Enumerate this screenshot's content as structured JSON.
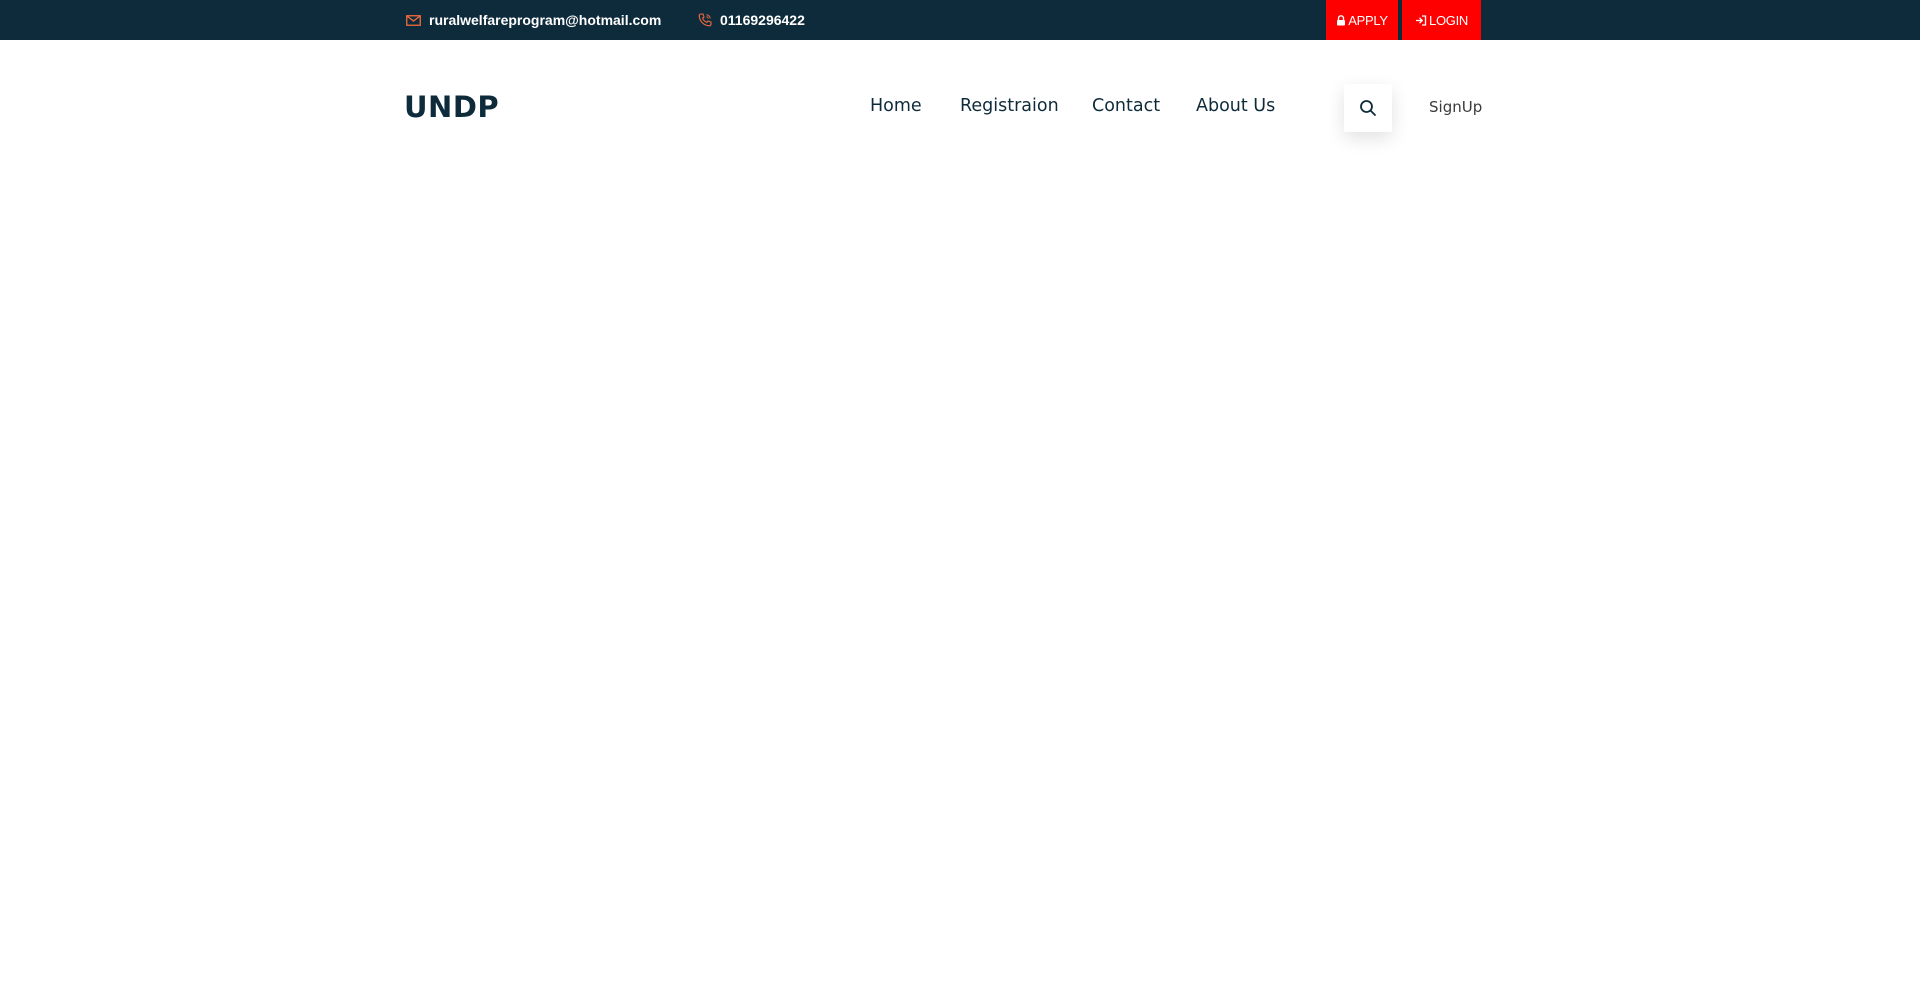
{
  "topbar": {
    "email": "ruralwelfareprogram@hotmail.com",
    "phone": "01169296422",
    "apply_label": "APPLY",
    "login_label": "LOGIN",
    "email_icon": "envelope-icon",
    "phone_icon": "phone-icon",
    "apply_icon": "lock-icon",
    "login_icon": "sign-in-icon"
  },
  "header": {
    "logo": "UNDP",
    "nav": [
      {
        "label": "Home"
      },
      {
        "label": "Registraion"
      },
      {
        "label": "Contact"
      },
      {
        "label": "About Us"
      }
    ],
    "search_icon": "search-icon",
    "signup_label": "SignUp"
  },
  "colors": {
    "topbar_bg": "#0e2b3b",
    "accent_red": "#ff0000",
    "icon_orange": "#f26a3d",
    "nav_text": "#0e2b3b"
  }
}
